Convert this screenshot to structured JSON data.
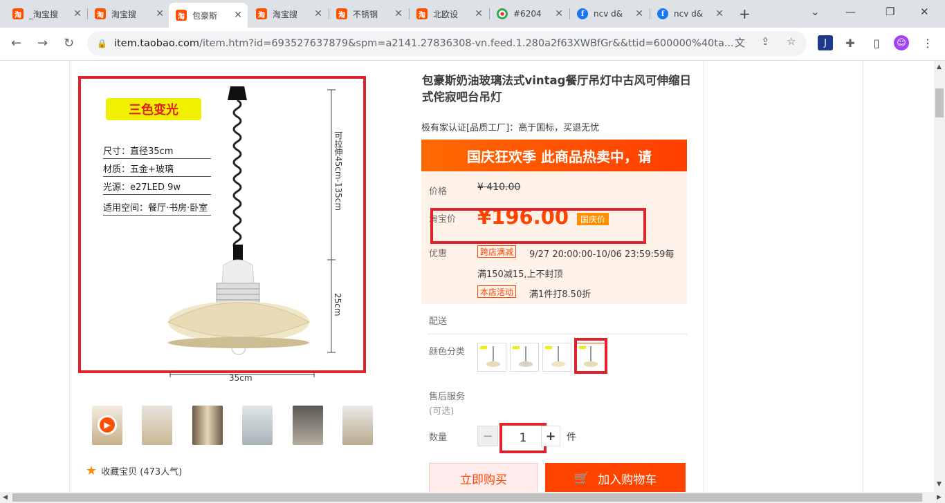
{
  "browser": {
    "tabs": [
      {
        "title": "_淘宝搜",
        "icon": "taobao-icon"
      },
      {
        "title": "淘宝搜",
        "icon": "taobao-icon"
      },
      {
        "title": "包豪斯",
        "icon": "taobao-icon"
      },
      {
        "title": "淘宝搜",
        "icon": "taobao-icon"
      },
      {
        "title": "不锈钢",
        "icon": "taobao-icon"
      },
      {
        "title": "北欧设",
        "icon": "taobao-icon"
      },
      {
        "title": "#6204",
        "icon": "chatgpt-icon"
      },
      {
        "title": "ncv d&",
        "icon": "facebook-icon"
      },
      {
        "title": "ncv d&",
        "icon": "facebook-icon"
      }
    ],
    "url_host": "item.taobao.com",
    "url_rest": "/item.htm?id=693527637879&spm=a2141.27836308-vn.feed.1.280a2f63XWBfGr&&ttid=600000%40ta..."
  },
  "image": {
    "badge": "三色变光",
    "specs": [
      "尺寸：直径35cm",
      "材质：五金+玻璃",
      "光源：e27LED 9w",
      "适用空间：餐厅·书房·卧室"
    ],
    "dim_stretch": "可拉伸45cm-135cm",
    "dim_height": "25cm",
    "dim_width": "35cm"
  },
  "favorite": "收藏宝贝 (473人气)",
  "product": {
    "title": "包豪斯奶油玻璃法式vintag餐厅吊灯中古风可伸缩日式侘寂吧台吊灯",
    "subtitle": "极有家认证[品质工厂]：高于国标，买退无忧",
    "banner": "国庆狂欢季 此商品热卖中，请",
    "price_label": "价格",
    "original_price": "¥ 410.00",
    "taobao_price_label": "淘宝价",
    "taobao_price": "¥196.00",
    "price_tag": "国庆价",
    "promo_label": "优惠",
    "promo1_tag": "跨店满减",
    "promo1_time": "9/27 20:00:00-10/06 23:59:59每",
    "promo1_desc": "满150减15,上不封顶",
    "promo2_tag": "本店活动",
    "promo2_desc": "满1件打8.50折",
    "delivery_label": "配送",
    "color_label": "颜色分类",
    "aftersale_label": "售后服务",
    "aftersale_note": "(可选)",
    "qty_label": "数量",
    "qty_value": "1",
    "qty_unit": "件",
    "buy_now": "立即购买",
    "add_cart": "加入购物车"
  },
  "colors": {
    "accent": "#ff4400",
    "highlight": "#e0222d"
  }
}
